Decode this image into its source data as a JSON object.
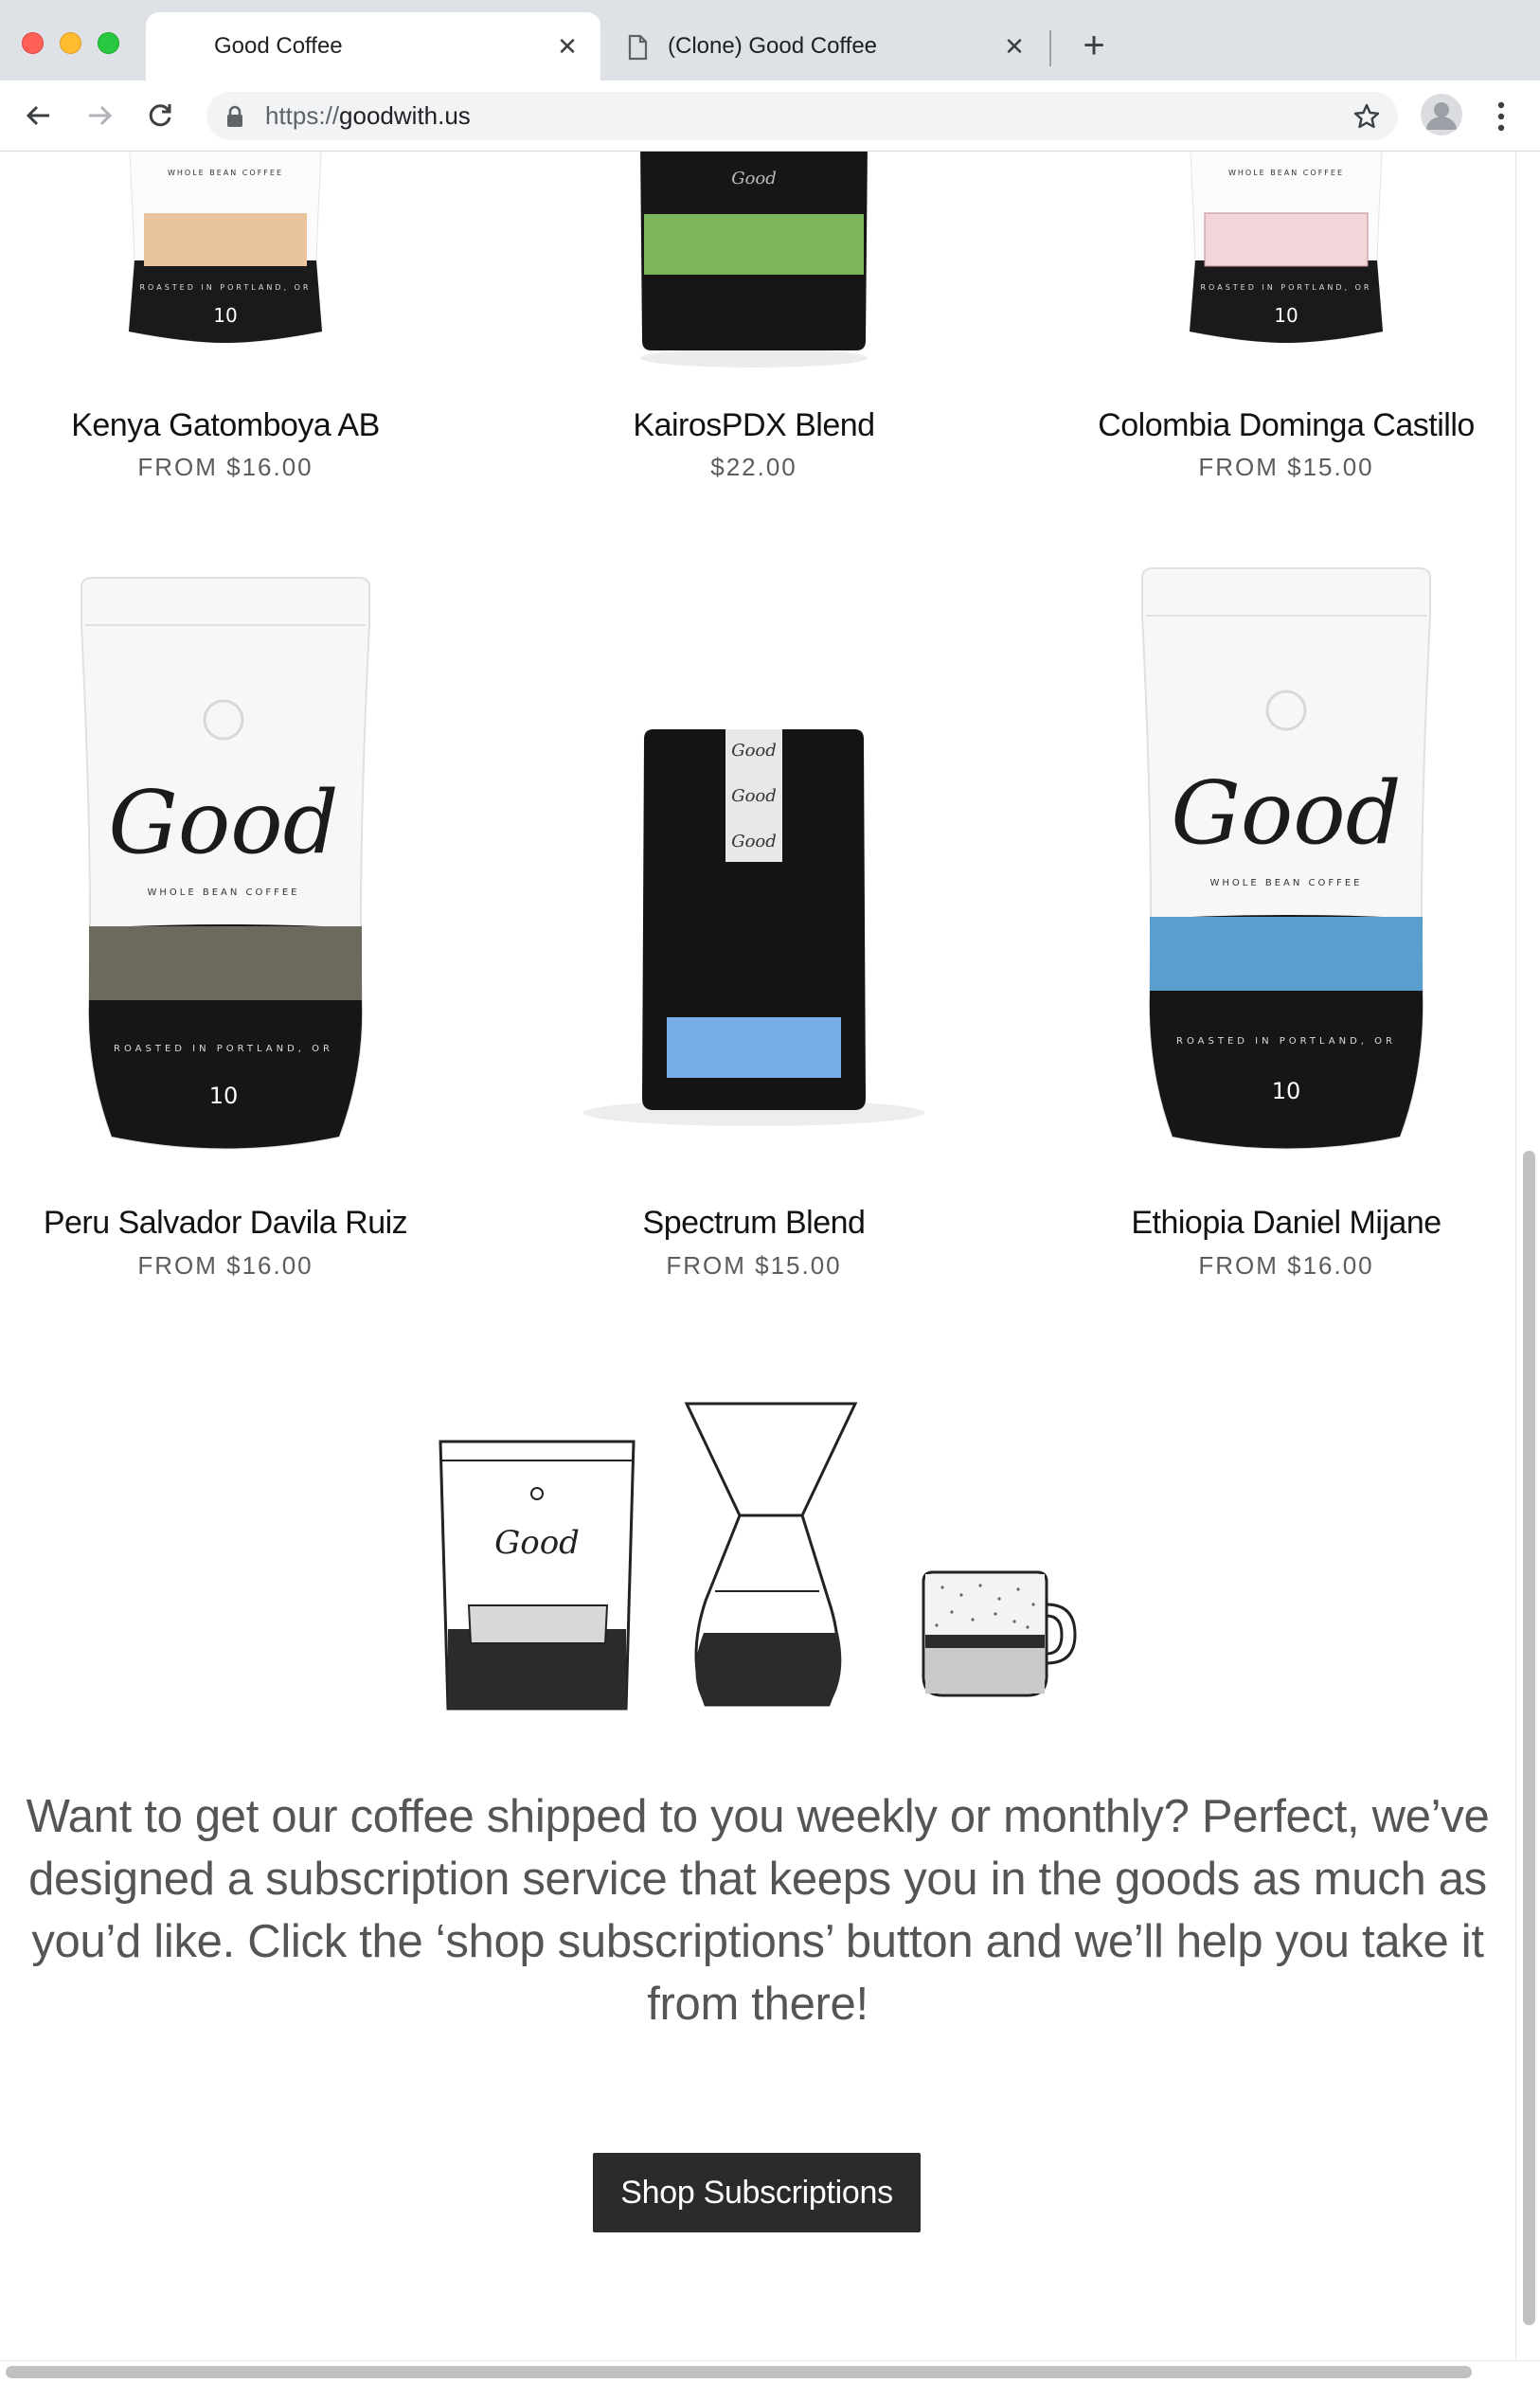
{
  "browser": {
    "tabs": [
      {
        "title": "Good Coffee",
        "active": true
      },
      {
        "title": "(Clone) Good Coffee",
        "active": false
      }
    ],
    "url_scheme": "https://",
    "url_host": "goodwith.us",
    "icons": {
      "back": "arrow-left-icon",
      "forward": "arrow-right-icon",
      "reload": "reload-icon",
      "lock": "lock-icon",
      "bookmark": "star-icon",
      "profile": "avatar-icon",
      "menu": "kebab-menu-icon",
      "tab_close": "close-icon",
      "new_tab": "plus-icon",
      "page": "page-icon"
    },
    "colors": {
      "close_red": "#fe5f57",
      "minimize_yellow": "#febc2e",
      "zoom_green": "#28c840"
    }
  },
  "products_row1": [
    {
      "name": "Kenya Gatomboya AB",
      "price": "FROM $16.00",
      "bag_style": "white",
      "label_color": "#e9c49e"
    },
    {
      "name": "KairosPDX Blend",
      "price": "$22.00",
      "bag_style": "black",
      "label_color": "#7cb65a"
    },
    {
      "name": "Colombia Dominga Castillo",
      "price": "FROM $15.00",
      "bag_style": "white",
      "label_color": "#f1d5d8"
    }
  ],
  "products_row2": [
    {
      "name": "Peru Salvador Davila Ruiz",
      "price": "FROM $16.00",
      "bag_style": "white",
      "label_color": "#6b6a5c"
    },
    {
      "name": "Spectrum Blend",
      "price": "FROM $15.00",
      "bag_style": "black",
      "label_color": "#76aee6"
    },
    {
      "name": "Ethiopia Daniel Mijane",
      "price": "FROM $16.00",
      "bag_style": "white",
      "label_color": "#5c9dd0"
    }
  ],
  "bag_logo": "Good",
  "subscription": {
    "text": "Want to get our coffee shipped to you weekly or monthly? Perfect, we’ve designed a subscription service that keeps you in the goods as much as you’d like. Click the ‘shop subscriptions’ button and we’ll help you take it from there!",
    "button_label": "Shop Subscriptions",
    "illustration_items": [
      "coffee-bag",
      "pour-over-carafe",
      "coffee-cup"
    ]
  }
}
